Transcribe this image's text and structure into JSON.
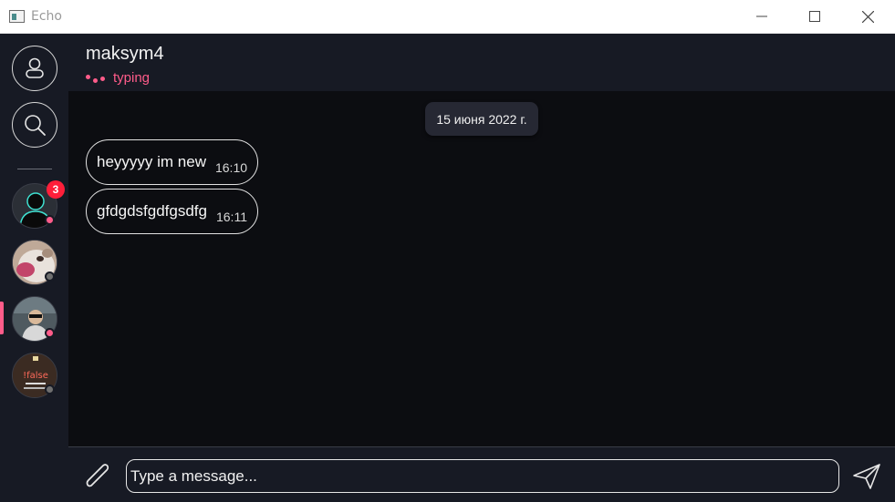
{
  "window": {
    "title": "Echo",
    "icons": {
      "app": "app-window-icon",
      "minimize": "minimize-icon",
      "maximize": "maximize-icon",
      "close": "close-icon"
    }
  },
  "sidebar": {
    "profile_icon": "user-icon",
    "search_icon": "search-icon",
    "chats": [
      {
        "avatar": "default-user-avatar",
        "unread": "3",
        "status": "online",
        "active": false
      },
      {
        "avatar": "cat-photo-avatar",
        "unread": "",
        "status": "offline",
        "active": false
      },
      {
        "avatar": "man-photo-avatar",
        "unread": "",
        "status": "online",
        "active": true
      },
      {
        "avatar": "false-logo-avatar",
        "avatar_text": "!false",
        "unread": "",
        "status": "offline",
        "active": false
      }
    ]
  },
  "header": {
    "contact_name": "maksym4",
    "status_text": "typing"
  },
  "messages": {
    "date_separator": "15 июня 2022 г.",
    "items": [
      {
        "text": "heyyyyy im new",
        "time": "16:10"
      },
      {
        "text": "gfdgdsfgdfgsdfg",
        "time": "16:11"
      }
    ]
  },
  "composer": {
    "placeholder": "Type a message...",
    "value": "",
    "attach_icon": "paperclip-icon",
    "send_icon": "send-icon"
  },
  "colors": {
    "accent": "#ff5c8a",
    "badge": "#ff1f3a",
    "panel": "#171a24",
    "background": "#0c0d11"
  }
}
